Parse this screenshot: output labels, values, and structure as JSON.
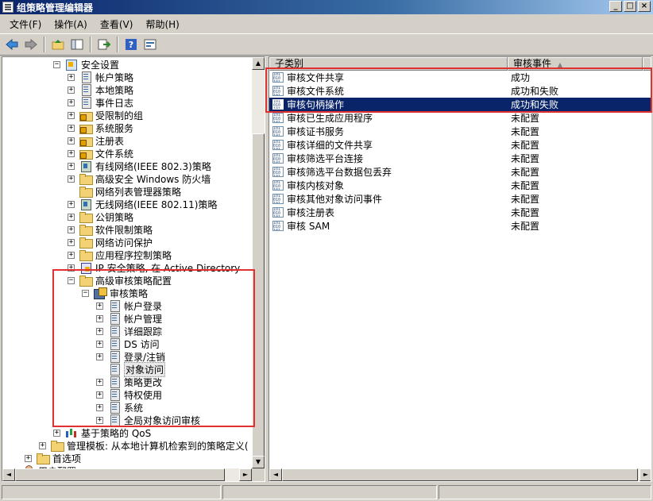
{
  "window": {
    "title": "组策略管理编辑器",
    "buttons": [
      "_",
      "□",
      "×"
    ]
  },
  "menu": [
    "文件(F)",
    "操作(A)",
    "查看(V)",
    "帮助(H)"
  ],
  "tree": {
    "nodes": [
      {
        "label": "安全设置",
        "exp": "−",
        "icon": "shield",
        "indent": 0
      },
      {
        "label": "帐户策略",
        "exp": "+",
        "icon": "policy",
        "indent": 1
      },
      {
        "label": "本地策略",
        "exp": "+",
        "icon": "policy",
        "indent": 1
      },
      {
        "label": "事件日志",
        "exp": "+",
        "icon": "policy",
        "indent": 1
      },
      {
        "label": "受限制的组",
        "exp": "+",
        "icon": "lockfolder",
        "indent": 1
      },
      {
        "label": "系统服务",
        "exp": "+",
        "icon": "lockfolder",
        "indent": 1
      },
      {
        "label": "注册表",
        "exp": "+",
        "icon": "lockfolder",
        "indent": 1
      },
      {
        "label": "文件系统",
        "exp": "+",
        "icon": "lockfolder",
        "indent": 1
      },
      {
        "label": "有线网络(IEEE 802.3)策略",
        "exp": "+",
        "icon": "network",
        "indent": 1
      },
      {
        "label": "高级安全 Windows 防火墙",
        "exp": "+",
        "icon": "folder",
        "indent": 1
      },
      {
        "label": "网络列表管理器策略",
        "exp": "",
        "icon": "folder",
        "indent": 1
      },
      {
        "label": "无线网络(IEEE 802.11)策略",
        "exp": "+",
        "icon": "network",
        "indent": 1
      },
      {
        "label": "公钥策略",
        "exp": "+",
        "icon": "folder",
        "indent": 1
      },
      {
        "label": "软件限制策略",
        "exp": "+",
        "icon": "folder",
        "indent": 1
      },
      {
        "label": "网络访问保护",
        "exp": "+",
        "icon": "folder",
        "indent": 1
      },
      {
        "label": "应用程序控制策略",
        "exp": "+",
        "icon": "folder",
        "indent": 1
      },
      {
        "label": "IP 安全策略, 在 Active Directory",
        "exp": "+",
        "icon": "ipsec",
        "indent": 1
      },
      {
        "label": "高级审核策略配置",
        "exp": "−",
        "icon": "folder",
        "indent": 1
      },
      {
        "label": "审核策略",
        "exp": "−",
        "icon": "audit",
        "indent": 2
      },
      {
        "label": "帐户登录",
        "exp": "+",
        "icon": "policy",
        "indent": 3
      },
      {
        "label": "帐户管理",
        "exp": "+",
        "icon": "policy",
        "indent": 3
      },
      {
        "label": "详细跟踪",
        "exp": "+",
        "icon": "policy",
        "indent": 3
      },
      {
        "label": "DS 访问",
        "exp": "+",
        "icon": "policy",
        "indent": 3
      },
      {
        "label": "登录/注销",
        "exp": "+",
        "icon": "policy",
        "indent": 3
      },
      {
        "label": "对象访问",
        "exp": "",
        "icon": "policy",
        "indent": 3,
        "highlight": true
      },
      {
        "label": "策略更改",
        "exp": "+",
        "icon": "policy",
        "indent": 3
      },
      {
        "label": "特权使用",
        "exp": "+",
        "icon": "policy",
        "indent": 3
      },
      {
        "label": "系统",
        "exp": "+",
        "icon": "policy",
        "indent": 3
      },
      {
        "label": "全局对象访问审核",
        "exp": "+",
        "icon": "policy",
        "indent": 3
      },
      {
        "label": "基于策略的 QoS",
        "exp": "+",
        "icon": "qos",
        "indent": 0
      },
      {
        "label": "管理模板: 从本地计算机检索到的策略定义(",
        "exp": "+",
        "icon": "folder",
        "indent": -1
      },
      {
        "label": "首选项",
        "exp": "+",
        "icon": "folder",
        "indent": -2
      },
      {
        "label": "用户配置",
        "exp": "",
        "icon": "user",
        "indent": -3
      }
    ]
  },
  "list": {
    "columns": [
      "子类别",
      "审核事件"
    ],
    "rows": [
      {
        "name": "审核文件共享",
        "value": "成功"
      },
      {
        "name": "审核文件系统",
        "value": "成功和失败"
      },
      {
        "name": "审核句柄操作",
        "value": "成功和失败",
        "selected": true
      },
      {
        "name": "审核已生成应用程序",
        "value": "未配置"
      },
      {
        "name": "审核证书服务",
        "value": "未配置"
      },
      {
        "name": "审核详细的文件共享",
        "value": "未配置"
      },
      {
        "name": "审核筛选平台连接",
        "value": "未配置"
      },
      {
        "name": "审核筛选平台数据包丢弃",
        "value": "未配置"
      },
      {
        "name": "审核内核对象",
        "value": "未配置"
      },
      {
        "name": "审核其他对象访问事件",
        "value": "未配置"
      },
      {
        "name": "审核注册表",
        "value": "未配置"
      },
      {
        "name": "审核 SAM",
        "value": "未配置"
      }
    ]
  },
  "colors": {
    "selection": "#0a246a",
    "annotation": "#e03030"
  }
}
